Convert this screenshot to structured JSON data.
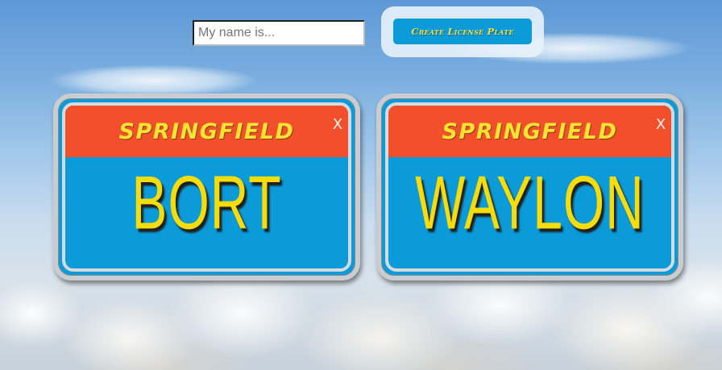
{
  "form": {
    "name_placeholder": "My name is...",
    "name_value": "",
    "create_button_label": "Create License Plate"
  },
  "plates": [
    {
      "city": "SPRINGFIELD",
      "name": "BORT",
      "close_label": "X"
    },
    {
      "city": "SPRINGFIELD",
      "name": "WAYLON",
      "close_label": "X"
    }
  ],
  "colors": {
    "plate_blue": "#0a9bd8",
    "header_red": "#f2502a",
    "text_yellow": "#f5dc0c",
    "frame_gray": "#c9cdd2"
  }
}
